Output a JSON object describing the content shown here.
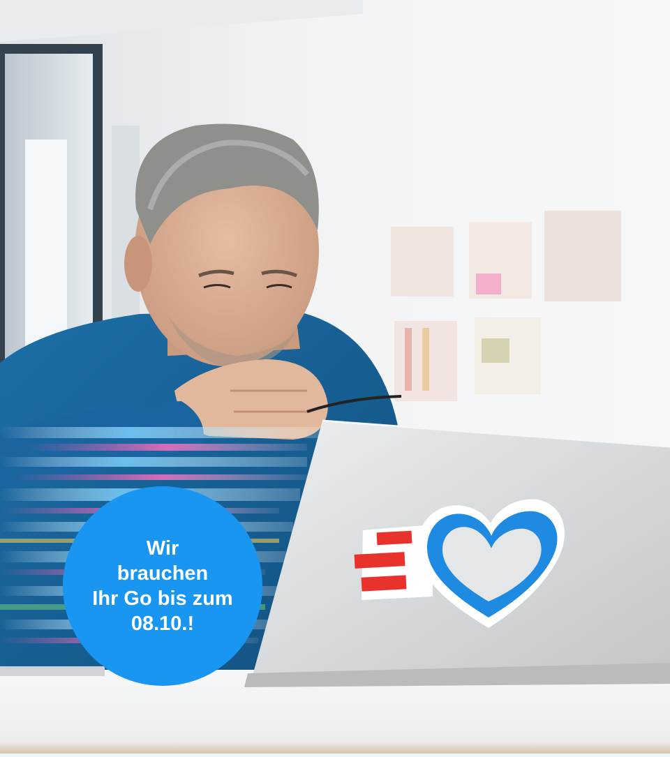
{
  "badge": {
    "lines": [
      "Wir",
      "brauchen",
      "Ihr Go bis zum",
      "08.10.!"
    ],
    "color": "#1896f2",
    "text_color": "#ffffff"
  },
  "photo": {
    "subject": "man-at-laptop",
    "sticker": "heart-sticker",
    "sticker_colors": {
      "heart": "#1f8ae2",
      "stripes": "#e8322c"
    }
  }
}
